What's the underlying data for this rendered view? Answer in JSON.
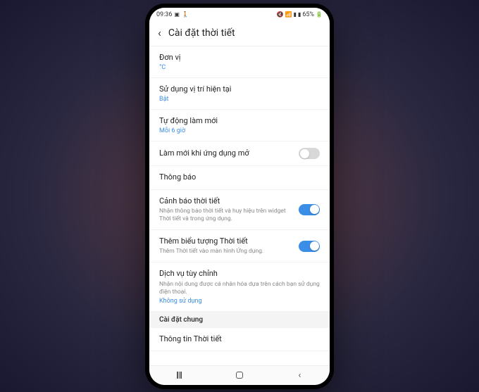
{
  "status": {
    "time": "09:36",
    "battery": "65%"
  },
  "header": {
    "title": "Cài đặt thời tiết"
  },
  "settings": {
    "unit": {
      "title": "Đơn vị",
      "value": "°C"
    },
    "location": {
      "title": "Sử dụng vị trí hiện tại",
      "value": "Bật"
    },
    "autorefresh": {
      "title": "Tự động làm mới",
      "value": "Mỗi 6 giờ"
    },
    "refreshopen": {
      "title": "Làm mới khi ứng dụng mở"
    },
    "notify": {
      "title": "Thông báo"
    },
    "alerts": {
      "title": "Cảnh báo thời tiết",
      "desc": "Nhận thông báo thời tiết và huy hiệu trên widget Thời tiết và trong ứng dụng."
    },
    "addicon": {
      "title": "Thêm biểu tượng Thời tiết",
      "desc": "Thêm Thời tiết vào màn hình Ứng dụng."
    },
    "custom": {
      "title": "Dịch vụ tùy chỉnh",
      "desc": "Nhận nội dung được cá nhân hóa dựa trên cách bạn sử dụng điện thoại.",
      "value": "Không sử dụng"
    }
  },
  "section": {
    "general": "Cài đặt chung"
  },
  "about": {
    "title": "Thông tin Thời tiết"
  }
}
